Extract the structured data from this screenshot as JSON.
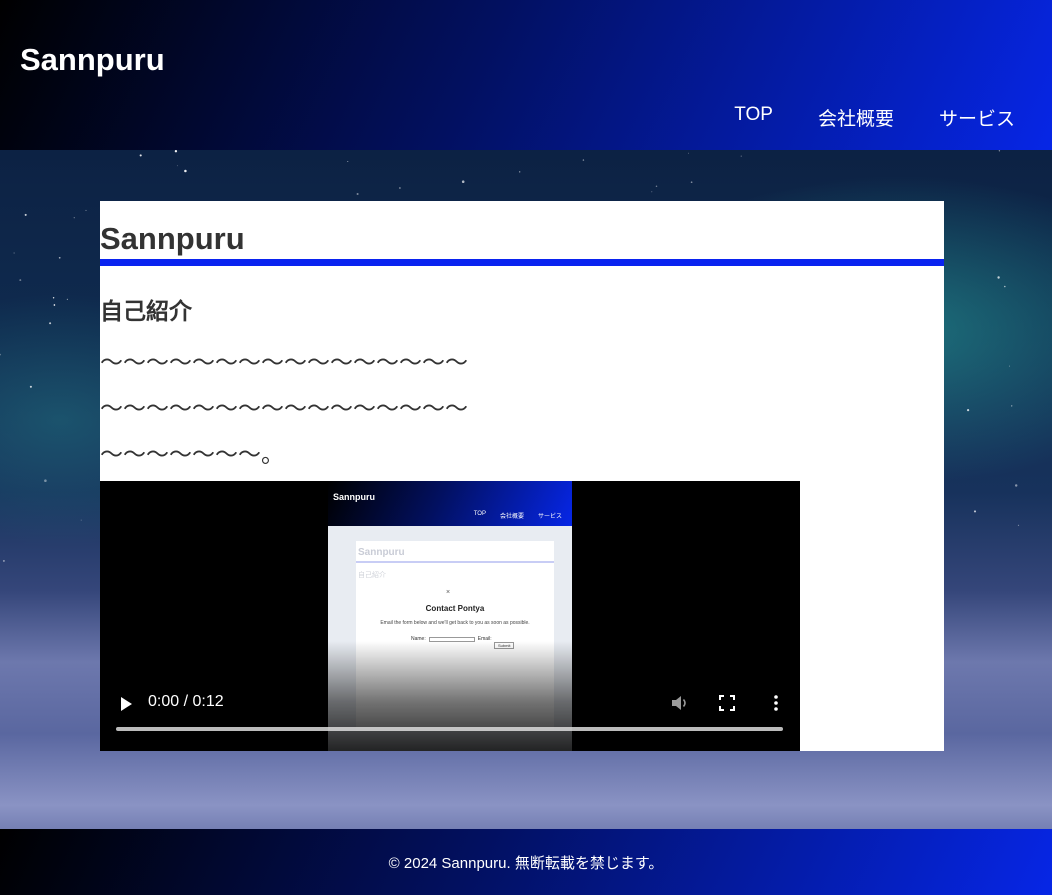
{
  "header": {
    "site_title": "Sannpuru",
    "nav": [
      "TOP",
      "会社概要",
      "サービス"
    ]
  },
  "main": {
    "title": "Sannpuru",
    "section_heading": "自己紹介",
    "paragraphs": [
      "〜〜〜〜〜〜〜〜〜〜〜〜〜〜〜〜",
      "〜〜〜〜〜〜〜〜〜〜〜〜〜〜〜〜",
      "〜〜〜〜〜〜〜。"
    ]
  },
  "video": {
    "time": "0:00 / 0:12",
    "progress": 0,
    "poster": {
      "site_title": "Sannpuru",
      "nav": [
        "TOP",
        "会社概要",
        "サービス"
      ],
      "card_title": "Sannpuru",
      "card_heading": "自己紹介",
      "modal_close": "×",
      "modal_title": "Contact Pontya",
      "modal_desc": "Email the form below and we'll get back to you as soon as possible.",
      "name_label": "Name:",
      "email_label": "Email:",
      "submit_label": "Submit"
    }
  },
  "footer": {
    "copyright": "© 2024 Sannpuru. 無断転載を禁じます。"
  },
  "colors": {
    "accent": "#0a23f0",
    "header_gradient_start": "#000000",
    "header_gradient_end": "#0626e6",
    "text": "#333333"
  },
  "icons": [
    "play-icon",
    "volume-icon",
    "fullscreen-icon",
    "more-vertical-icon"
  ]
}
